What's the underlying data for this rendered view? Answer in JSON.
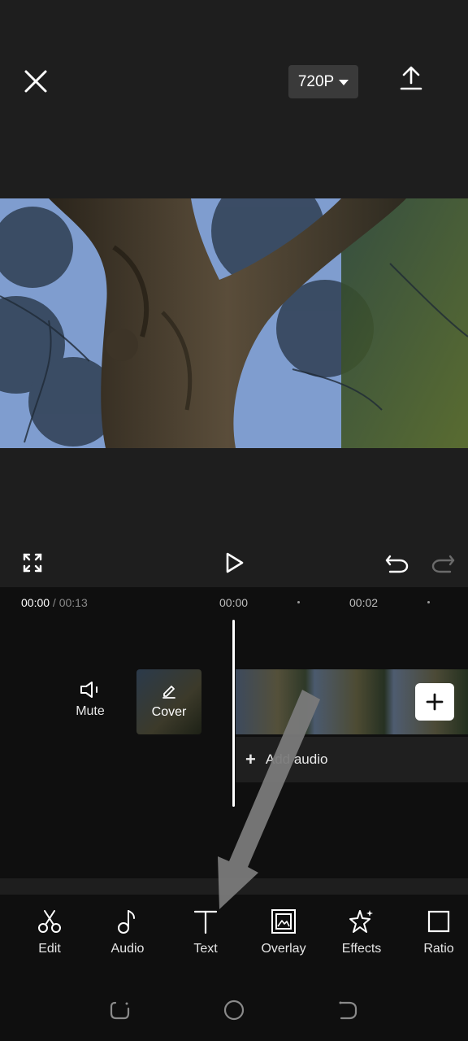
{
  "header": {
    "resolution_label": "720P",
    "close_icon": "close-icon",
    "export_icon": "export-icon"
  },
  "controls": {
    "fullscreen_icon": "fullscreen-icon",
    "play_icon": "play-icon",
    "undo_icon": "undo-icon",
    "redo_icon": "redo-icon"
  },
  "timeline": {
    "current_time": "00:00",
    "separator": " / ",
    "total_time": "00:13",
    "ticks": [
      "00:00",
      "00:02"
    ],
    "mute_label": "Mute",
    "cover_label": "Cover",
    "add_audio_label": "Add audio",
    "add_audio_plus": "+"
  },
  "toolbar": {
    "items": [
      {
        "label": "Edit",
        "icon": "scissors-icon"
      },
      {
        "label": "Audio",
        "icon": "music-note-icon"
      },
      {
        "label": "Text",
        "icon": "text-icon"
      },
      {
        "label": "Overlay",
        "icon": "overlay-icon"
      },
      {
        "label": "Effects",
        "icon": "sparkle-star-icon"
      },
      {
        "label": "Ratio",
        "icon": "ratio-square-icon"
      }
    ]
  },
  "navbar": {
    "recents_icon": "recents-icon",
    "home_icon": "home-circle-icon",
    "back_icon": "back-icon"
  },
  "colors": {
    "background": "#1e1e1e",
    "timeline_bg": "#0f0f0f",
    "accent_white": "#ffffff",
    "arrow_gray": "#7a7a7a"
  }
}
